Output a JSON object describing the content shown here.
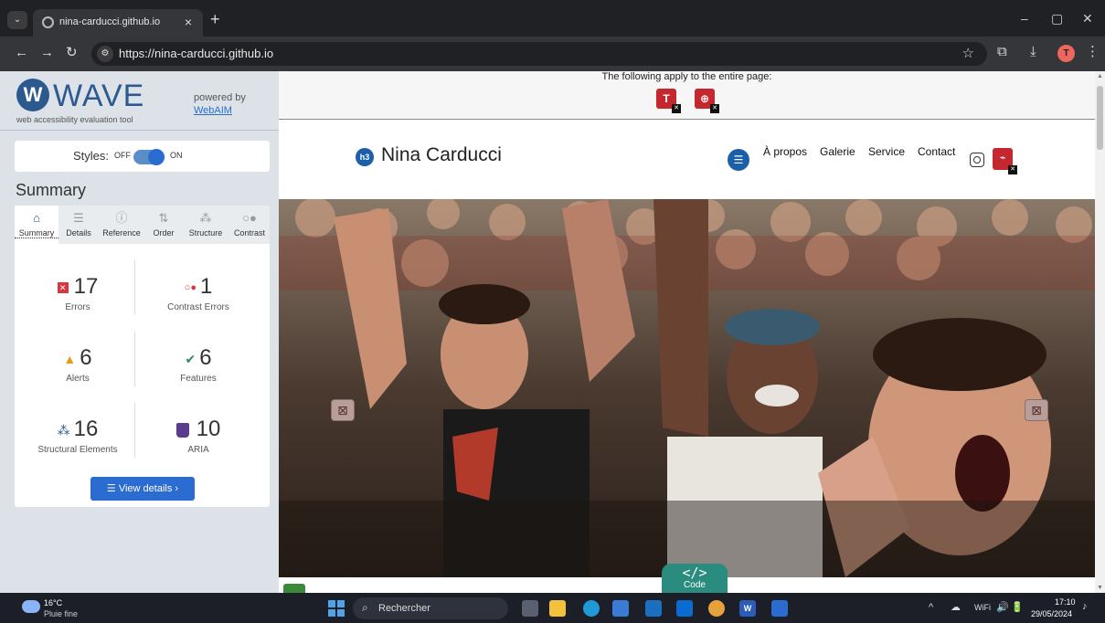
{
  "browser": {
    "tab_title": "nina-carducci.github.io",
    "tab_close": "×",
    "new_tab": "+",
    "url": "https://nina-carducci.github.io",
    "profile_initial": "T",
    "window": {
      "minimize": "–",
      "maximize": "▢",
      "close": "✕"
    }
  },
  "wave": {
    "logo_mark": "W",
    "logo_text": "WAVE",
    "logo_subtitle": "web accessibility evaluation tool",
    "powered_by": "powered by",
    "powered_link": "WebAIM",
    "styles_label": "Styles:",
    "styles_off": "OFF",
    "styles_on": "ON",
    "section_title": "Summary",
    "tabs": [
      {
        "label": "Summary",
        "icon": "home-icon",
        "glyph": "⌂"
      },
      {
        "label": "Details",
        "icon": "list-icon",
        "glyph": "☰"
      },
      {
        "label": "Reference",
        "icon": "info-icon",
        "glyph": "ⓘ"
      },
      {
        "label": "Order",
        "icon": "order-icon",
        "glyph": "⇅"
      },
      {
        "label": "Structure",
        "icon": "structure-icon",
        "glyph": "⁂"
      },
      {
        "label": "Contrast",
        "icon": "contrast-icon",
        "glyph": "○●"
      }
    ],
    "stats": {
      "errors": {
        "count": "17",
        "label": "Errors",
        "color": "#d9363e"
      },
      "contrast": {
        "count": "1",
        "label": "Contrast Errors",
        "glyph": "○●",
        "color": "#d9363e"
      },
      "alerts": {
        "count": "6",
        "label": "Alerts",
        "glyph": "▲",
        "color": "#e69a1e"
      },
      "features": {
        "count": "6",
        "label": "Features",
        "glyph": "✔",
        "color": "#2e8b57"
      },
      "structural": {
        "count": "16",
        "label": "Structural Elements",
        "glyph": "⁂",
        "color": "#2c5a8e"
      },
      "aria": {
        "count": "10",
        "label": "ARIA",
        "color": "#5c3c8c"
      }
    },
    "view_details": "☰  View details ›"
  },
  "page": {
    "applies_text": "The following apply to the entire page:",
    "badges": {
      "text_badge": "T",
      "lang_badge": "⊕"
    },
    "h3_badge": "h3",
    "site_name": "Nina Carducci",
    "list_badge": "☰",
    "nav": [
      "À propos",
      "Galerie",
      "Service",
      "Contact"
    ],
    "code_symbol": "</>",
    "code_label": "Code"
  },
  "taskbar": {
    "temp": "16°C",
    "weather": "Pluie fine",
    "search": "Rechercher",
    "time": "17:10",
    "date": "29/05/2024",
    "tray_icons": [
      "^",
      "☁",
      "WiFi",
      "🔊",
      "🔋"
    ]
  }
}
